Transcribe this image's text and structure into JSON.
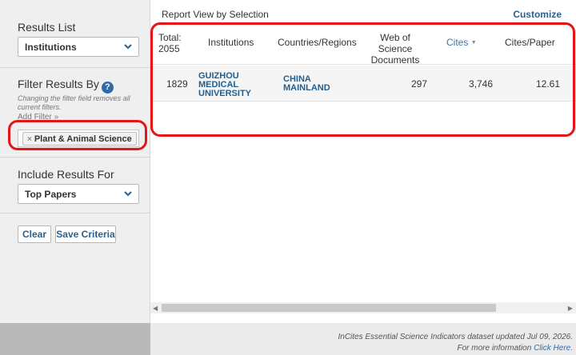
{
  "sidebar": {
    "results_list": {
      "heading": "Results List",
      "selected": "Institutions"
    },
    "filter": {
      "heading": "Filter Results By",
      "help": "?",
      "note": "Changing the filter field removes all current filters.",
      "add_filter": "Add Filter »",
      "chip_remove": "×",
      "chip_label": "Plant & Animal Science"
    },
    "include": {
      "heading": "Include Results For",
      "selected": "Top Papers"
    },
    "buttons": {
      "clear": "Clear",
      "save": "Save Criteria"
    }
  },
  "report": {
    "title": "Report View by Selection",
    "customize": "Customize",
    "columns": {
      "total_label": "Total:",
      "total_value": "2055",
      "institutions": "Institutions",
      "countries": "Countries/Regions",
      "wos_line1": "Web of Science",
      "wos_line2": "Documents",
      "cites": "Cites",
      "cites_sort": "▼",
      "cites_per_paper": "Cites/Paper"
    },
    "rows": [
      {
        "rank": "1829",
        "institution_line1": "GUIZHOU",
        "institution_line2": "MEDICAL",
        "institution_line3": "UNIVERSITY",
        "country_line1": "CHINA",
        "country_line2": "MAINLAND",
        "documents": "297",
        "cites": "3,746",
        "cites_per_paper": "12.61"
      }
    ]
  },
  "scrollbar": {
    "left_arrow": "◀",
    "right_arrow": "▶"
  },
  "footer": {
    "line1": "InCites Essential Science Indicators dataset updated Jul 09, 2026.",
    "line2_text": "For more information",
    "line2_link": "Click Here."
  },
  "colors": {
    "highlight": "#e51515",
    "link": "#1f5e8f",
    "help_icon": "#2e6aa8"
  }
}
